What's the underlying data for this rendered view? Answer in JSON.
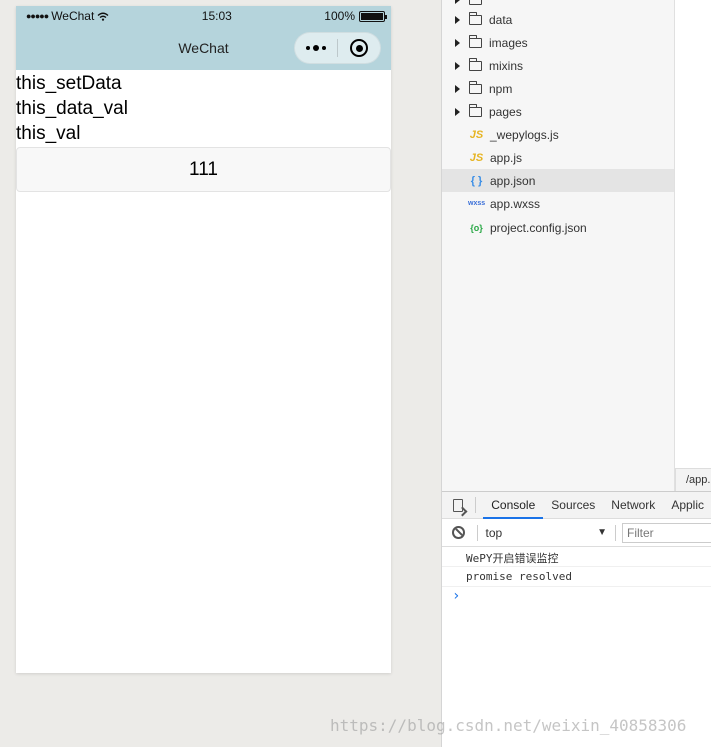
{
  "phone": {
    "status_bar": {
      "signal": "●●●●●",
      "carrier": "WeChat",
      "wifi": "wifi-icon",
      "time": "15:03",
      "battery": "100%"
    },
    "nav_title": "WeChat",
    "content_lines": [
      "this_setData",
      "this_data_val",
      "this_val"
    ],
    "button_label": "111"
  },
  "file_tree": {
    "items": [
      {
        "type": "folder",
        "label": "data"
      },
      {
        "type": "folder",
        "label": "images"
      },
      {
        "type": "folder",
        "label": "mixins"
      },
      {
        "type": "folder",
        "label": "npm"
      },
      {
        "type": "folder",
        "label": "pages"
      },
      {
        "type": "file",
        "icon": "JS",
        "label": "_wepylogs.js"
      },
      {
        "type": "file",
        "icon": "JS",
        "label": "app.js"
      },
      {
        "type": "file",
        "icon": "{ }",
        "label": "app.json",
        "selected": true
      },
      {
        "type": "file",
        "icon": "wxss",
        "label": "app.wxss"
      },
      {
        "type": "file",
        "icon": "{o}",
        "label": "project.config.json"
      }
    ]
  },
  "editor": {
    "tab_label": "/app."
  },
  "devtools": {
    "tabs": [
      "Console",
      "Sources",
      "Network",
      "Applic"
    ],
    "active_tab": "Console",
    "context": "top",
    "filter_placeholder": "Filter",
    "logs": [
      "WePY开启错误监控",
      "promise resolved"
    ],
    "prompt": "›"
  },
  "watermark": "https://blog.csdn.net/weixin_40858306",
  "colors": {
    "nav_bar": "#b5d4dc",
    "accent": "#1a73e8"
  }
}
